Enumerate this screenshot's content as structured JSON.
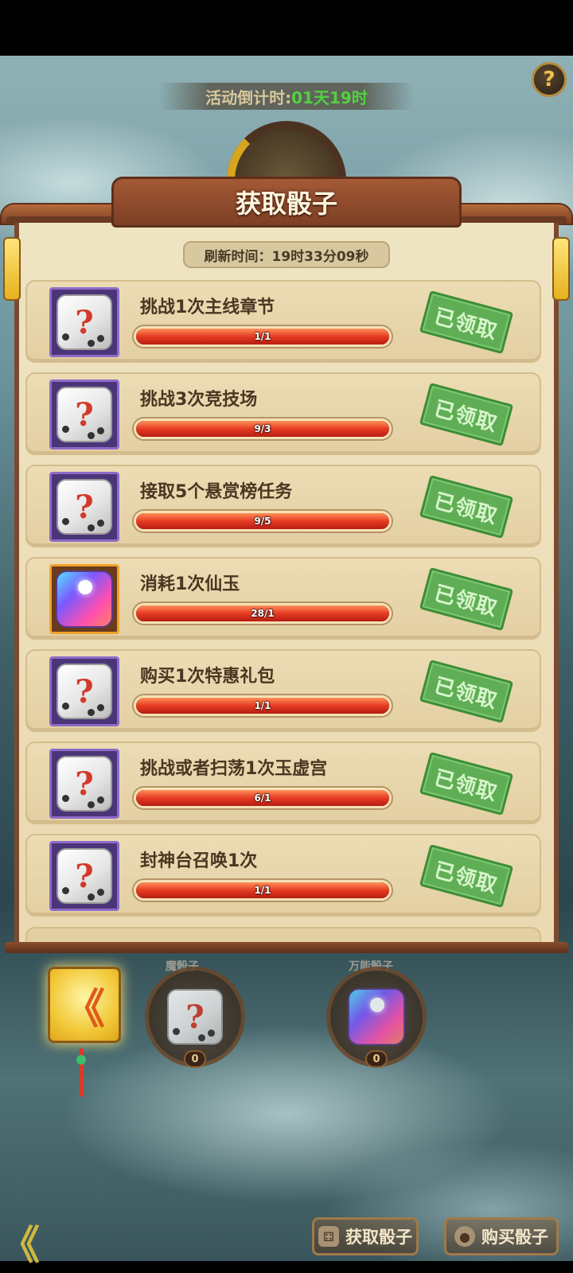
{
  "top": {
    "help_glyph": "?",
    "countdown_label": "活动倒计时:",
    "countdown_value": "01天19时"
  },
  "panel": {
    "title": "获取骰子",
    "refresh_text": "刷新时间：19时33分09秒"
  },
  "tasks": [
    {
      "label": "挑战1次主线章节",
      "progress": "1/1",
      "fill": 1.0,
      "icon": "white-question-dice-icon",
      "status": "已领取"
    },
    {
      "label": "挑战3次竞技场",
      "progress": "9/3",
      "fill": 1.0,
      "icon": "white-question-dice-icon",
      "status": "已领取"
    },
    {
      "label": "接取5个悬赏榜任务",
      "progress": "9/5",
      "fill": 1.0,
      "icon": "white-question-dice-icon",
      "status": "已领取"
    },
    {
      "label": "消耗1次仙玉",
      "progress": "28/1",
      "fill": 1.0,
      "icon": "magic-dice-icon",
      "status": "已领取"
    },
    {
      "label": "购买1次特惠礼包",
      "progress": "1/1",
      "fill": 1.0,
      "icon": "white-question-dice-icon",
      "status": "已领取"
    },
    {
      "label": "挑战或者扫荡1次玉虚宫",
      "progress": "6/1",
      "fill": 1.0,
      "icon": "white-question-dice-icon",
      "status": "已领取"
    },
    {
      "label": "封神台召唤1次",
      "progress": "1/1",
      "fill": 1.0,
      "icon": "white-question-dice-icon",
      "status": "已领取"
    }
  ],
  "dice_glyph": "?",
  "bottom": {
    "back_glyph": "《",
    "slots": [
      {
        "label": "魔骰子",
        "count": "0"
      },
      {
        "label": "万能骰子",
        "count": "0"
      }
    ],
    "get_dice": "获取骰子",
    "buy_dice": "购买骰子"
  },
  "colors": {
    "accent_green": "#53d141",
    "stamp_green": "#5fae55",
    "bar_red": "#e53c22",
    "panel_parchment": "#efe4c2"
  }
}
